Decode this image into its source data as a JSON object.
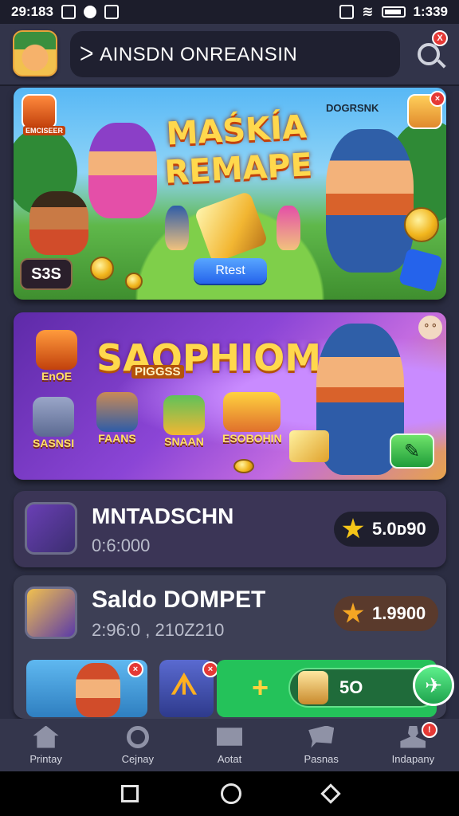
{
  "status_bar": {
    "time": "29:183",
    "time_right": "1:339"
  },
  "header": {
    "search_text": "ᐳ AINSDN ONREANSIN",
    "search_badge": "X"
  },
  "banner1": {
    "title_line1": "MAŚKÍA",
    "title_line2": "REMAPE",
    "left_tag": "EMCISEER",
    "right_tag": "DOGRSNK",
    "score": "S3S",
    "button_label": "Rtest"
  },
  "banner2": {
    "title": "SAOPHIOM",
    "subtitle": "PIGGSS",
    "chat": "° °",
    "games": [
      {
        "label": "EnOE"
      },
      {
        "label": "SASNSI"
      },
      {
        "label": "FAANS"
      },
      {
        "label": "SNAAN"
      },
      {
        "label": "ESOBOHIN"
      }
    ],
    "action_glyph": "✎"
  },
  "card1": {
    "title": "MNTADSCHN",
    "subtitle": "0:6:000",
    "value": "5.0ᴅ90"
  },
  "card2": {
    "title": "Saldo DOMPET",
    "subtitle": "2:96:0 , 210Z210",
    "value": "1.9900",
    "mini_tile_label": "ᗑ",
    "wallet_label": "5O",
    "send_glyph": "✈"
  },
  "bottom_nav": [
    {
      "label": "Printay"
    },
    {
      "label": "Cejnay"
    },
    {
      "label": "Aotat"
    },
    {
      "label": "Pasnas"
    },
    {
      "label": "Indapany"
    }
  ],
  "colors": {
    "background": "#2b2d42",
    "accent_gold": "#ffd84d",
    "accent_green": "#1fa34e",
    "badge_red": "#e53935"
  }
}
